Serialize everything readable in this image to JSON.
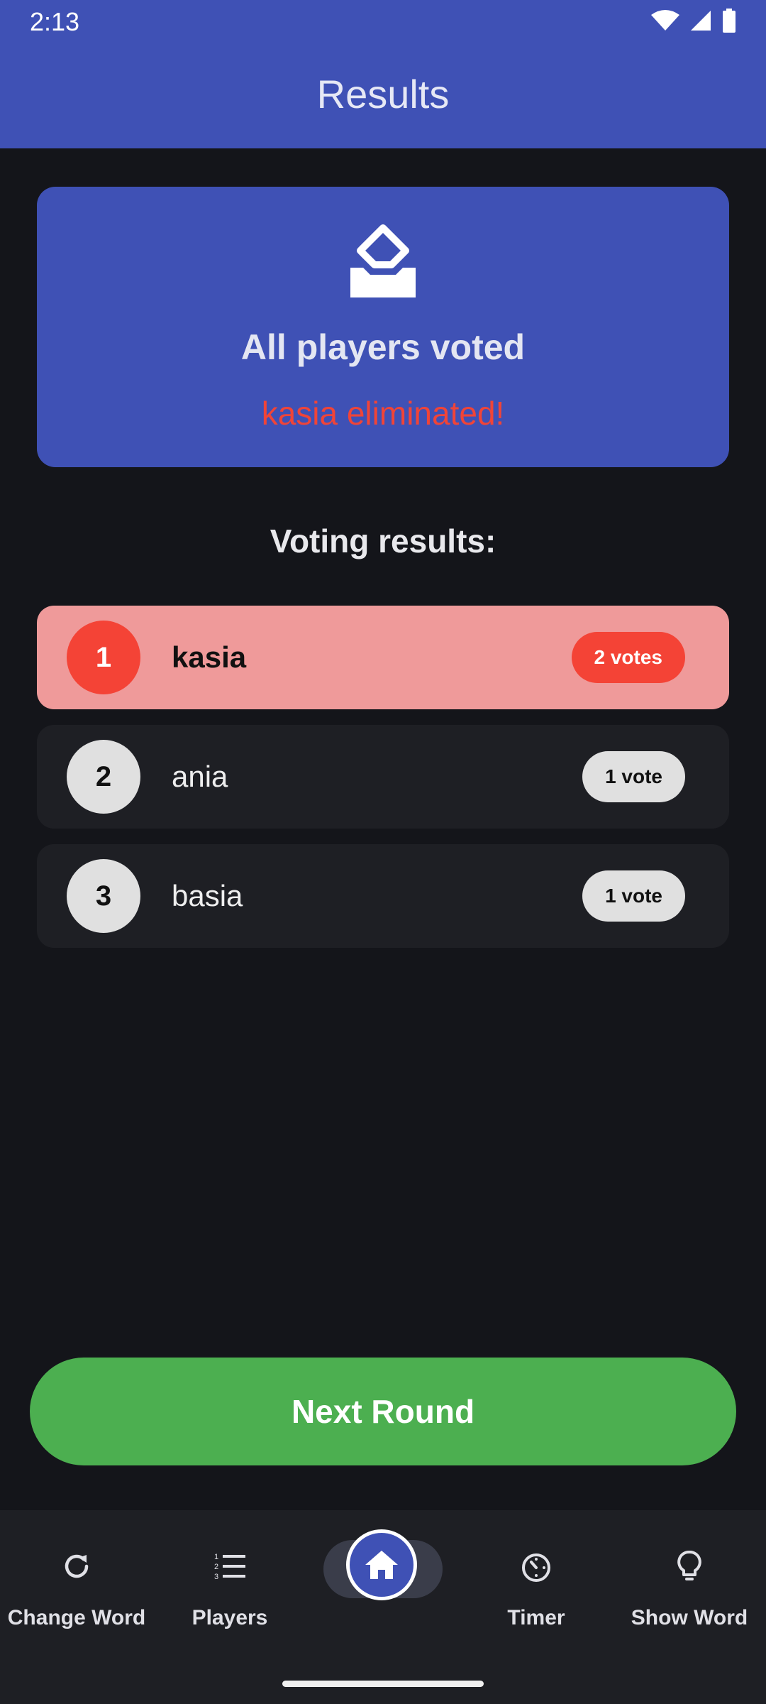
{
  "status_bar": {
    "time": "2:13"
  },
  "app_bar": {
    "title": "Results"
  },
  "summary_card": {
    "icon": "ballot-box-icon",
    "headline": "All players voted",
    "eliminated_text": "kasia eliminated!"
  },
  "results": {
    "title": "Voting results:",
    "rows": [
      {
        "rank": "1",
        "name": "kasia",
        "votes": "2 votes"
      },
      {
        "rank": "2",
        "name": "ania",
        "votes": "1 vote"
      },
      {
        "rank": "3",
        "name": "basia",
        "votes": "1 vote"
      }
    ]
  },
  "actions": {
    "next_round": "Next Round"
  },
  "bottom_nav": {
    "items": [
      {
        "label": "Change Word",
        "icon": "refresh-icon"
      },
      {
        "label": "Players",
        "icon": "numbered-list-icon"
      },
      {
        "label": "",
        "icon": "home-icon"
      },
      {
        "label": "Timer",
        "icon": "timer-icon"
      },
      {
        "label": "Show Word",
        "icon": "lightbulb-icon"
      }
    ]
  },
  "colors": {
    "primary": "#3f51b5",
    "eliminated": "#f44336",
    "next_button": "#4caf50",
    "background": "#14151a"
  }
}
